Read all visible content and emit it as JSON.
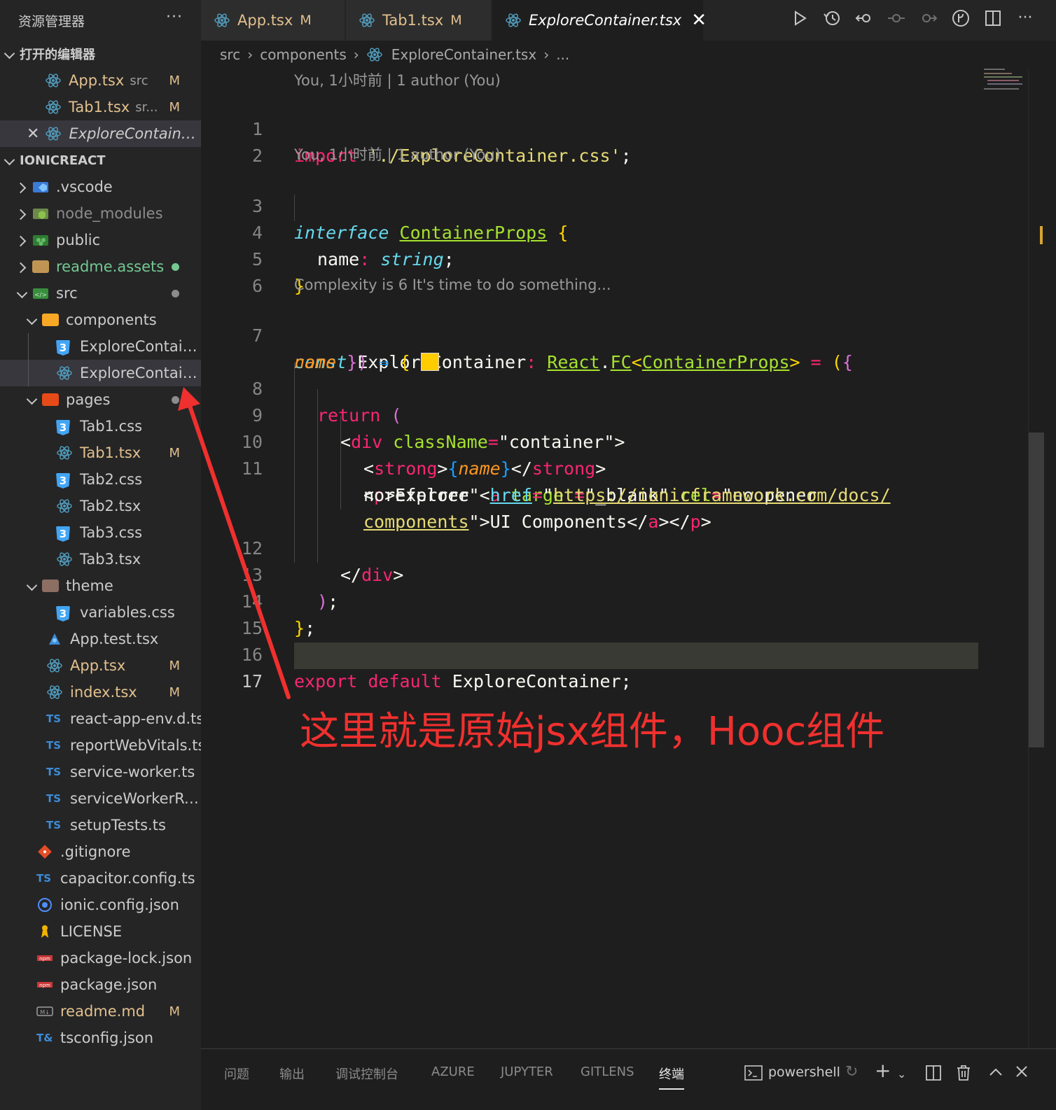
{
  "sidebar": {
    "title": "资源管理器",
    "more": "···",
    "open_editors_label": "打开的编辑器",
    "open_editors": [
      {
        "name": "App.tsx",
        "path": "src",
        "status": "M"
      },
      {
        "name": "Tab1.tsx",
        "path": "sr...",
        "status": "M"
      },
      {
        "name": "ExploreContainer...",
        "path": "",
        "status": ""
      }
    ],
    "project_label": "IONICREACT",
    "tree": [
      {
        "name": ".vscode",
        "status": ""
      },
      {
        "name": "node_modules",
        "status": ""
      },
      {
        "name": "public",
        "status": ""
      },
      {
        "name": "readme.assets",
        "status": ""
      },
      {
        "name": "src",
        "status": ""
      },
      {
        "name": "components",
        "status": ""
      },
      {
        "name": "ExploreContain...",
        "status": ""
      },
      {
        "name": "ExploreContain...",
        "status": ""
      },
      {
        "name": "pages",
        "status": ""
      },
      {
        "name": "Tab1.css",
        "status": ""
      },
      {
        "name": "Tab1.tsx",
        "status": "M"
      },
      {
        "name": "Tab2.css",
        "status": ""
      },
      {
        "name": "Tab2.tsx",
        "status": ""
      },
      {
        "name": "Tab3.css",
        "status": ""
      },
      {
        "name": "Tab3.tsx",
        "status": ""
      },
      {
        "name": "theme",
        "status": ""
      },
      {
        "name": "variables.css",
        "status": ""
      },
      {
        "name": "App.test.tsx",
        "status": ""
      },
      {
        "name": "App.tsx",
        "status": "M"
      },
      {
        "name": "index.tsx",
        "status": "M"
      },
      {
        "name": "react-app-env.d.ts",
        "status": ""
      },
      {
        "name": "reportWebVitals.ts",
        "status": ""
      },
      {
        "name": "service-worker.ts",
        "status": ""
      },
      {
        "name": "serviceWorkerRe...",
        "status": ""
      },
      {
        "name": "setupTests.ts",
        "status": ""
      },
      {
        "name": ".gitignore",
        "status": ""
      },
      {
        "name": "capacitor.config.ts",
        "status": ""
      },
      {
        "name": "ionic.config.json",
        "status": ""
      },
      {
        "name": "LICENSE",
        "status": ""
      },
      {
        "name": "package-lock.json",
        "status": ""
      },
      {
        "name": "package.json",
        "status": ""
      },
      {
        "name": "readme.md",
        "status": "M"
      },
      {
        "name": "tsconfig.json",
        "status": ""
      }
    ]
  },
  "tabs": [
    {
      "label": "App.tsx",
      "status": "M"
    },
    {
      "label": "Tab1.tsx",
      "status": "M"
    },
    {
      "label": "ExploreContainer.tsx",
      "status": "",
      "close": "✕"
    }
  ],
  "breadcrumb": [
    "src",
    "components",
    "ExploreContainer.tsx",
    "..."
  ],
  "codelens": {
    "blame1": "You, 1小时前 | 1 author (You)",
    "blame2": "You, 1小时前 | 1 author (You)",
    "complexity": "Complexity is 6 It's time to do something..."
  },
  "line_numbers": [
    "1",
    "2",
    "3",
    "4",
    "5",
    "6",
    "7",
    "8",
    "9",
    "10",
    "11",
    "12",
    "13",
    "14",
    "15",
    "16",
    "17"
  ],
  "code": {
    "l1_kw": "import",
    "l1_str": "'./ExploreContainer.css'",
    "l1_end": ";",
    "l3_kw": "interface",
    "l3_type": "ContainerProps",
    "l3_brace": "{",
    "l4_name": "name",
    "l4_colon": ":",
    "l4_type": "string",
    "l4_end": ";",
    "l5_brace": "}",
    "l7_kw": "const",
    "l7_name": "ExploreContainer",
    "l7_colon": ":",
    "l7_react": "React",
    "l7_dot": ".",
    "l7_fc": "FC",
    "l7_lt": "<",
    "l7_props": "ContainerProps",
    "l7_gt": ">",
    "l7_eq": "=",
    "l7_paren": "(",
    "l7_brace": "{",
    "l7b_param": "name",
    "l7b_close": "})",
    "l7b_arrow": "⇒",
    "l7b_brace": "{",
    "l8_kw": "return",
    "l8_paren": "(",
    "l9_open": "<",
    "l9_tag": "div",
    "l9_attr": "className",
    "l9_eq": "=",
    "l9_val": "\"container\"",
    "l9_close": ">",
    "l10_open": "<",
    "l10_tag": "strong",
    "l10_gt": ">",
    "l10_lb": "{",
    "l10_name": "name",
    "l10_rb": "}",
    "l10_close_open": "</",
    "l10_close_tag": "strong",
    "l10_close_gt": ">",
    "l11_open": "<",
    "l11_p": "p",
    "l11_text": ">Explore ",
    "l11_a_open": "<",
    "l11_a": "a",
    "l11_target": "target",
    "l11_eq1": "=",
    "l11_target_val": "\"_blank\"",
    "l11_rel": "rel",
    "l11_eq2": "=",
    "l11_rel_val": "\"noopener",
    "l11b_rel_val": "noreferrer\"",
    "l11b_href": "href",
    "l11b_eq": "=",
    "l11b_quote": "\"",
    "l11b_url": "https://ionicframework.com/docs/",
    "l11c_url": "components",
    "l11c_text": "\">UI Components",
    "l11c_close_a_open": "</",
    "l11c_a": "a",
    "l11c_gt": "></",
    "l11c_p": "p",
    "l11c_end": ">",
    "l12_open": "</",
    "l12_tag": "div",
    "l12_gt": ">",
    "l13_paren": ")",
    "l13_semi": ";",
    "l14_brace": "}",
    "l14_semi": ";",
    "l16_kw1": "export",
    "l16_kw2": "default",
    "l16_name": "ExploreContainer",
    "l16_semi": ";"
  },
  "annotation": "这里就是原始jsx组件，Hooc组件",
  "panel": {
    "tabs": [
      "问题",
      "输出",
      "调试控制台",
      "AZURE",
      "JUPYTER",
      "GITLENS",
      "终端"
    ],
    "terminal": "powershell"
  }
}
